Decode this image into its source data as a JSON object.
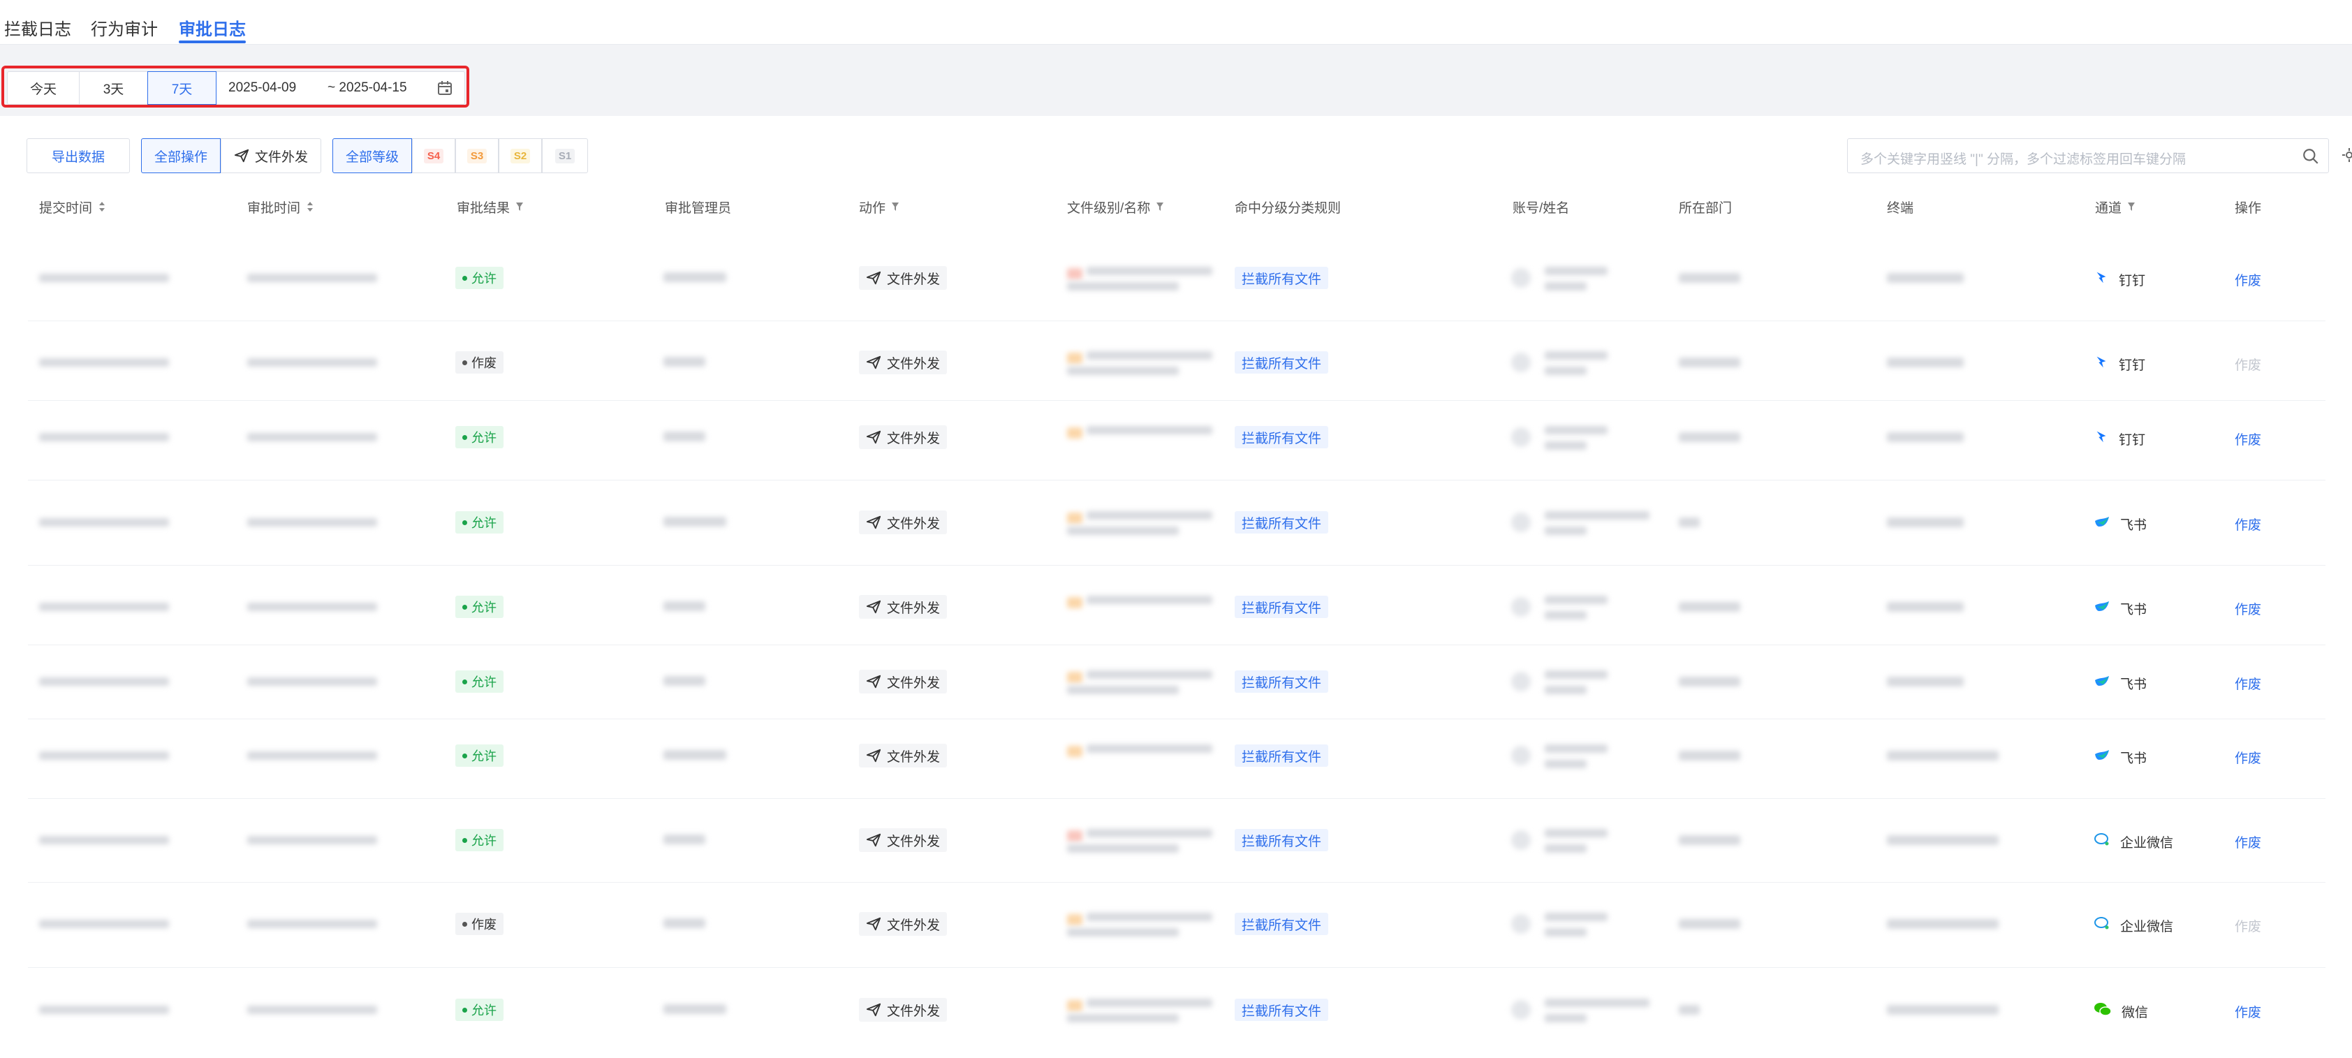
{
  "top_tabs": [
    {
      "label": "拦截日志",
      "active": false
    },
    {
      "label": "行为审计",
      "active": false
    },
    {
      "label": "审批日志",
      "active": true
    }
  ],
  "date_filter": {
    "buttons": [
      {
        "label": "今天",
        "active": false
      },
      {
        "label": "3天",
        "active": false
      },
      {
        "label": "7天",
        "active": true
      }
    ],
    "start": "2025-04-09",
    "end": "~ 2025-04-15"
  },
  "toolbar": {
    "export_label": "导出数据",
    "operation_all": "全部操作",
    "operation_send": "文件外发",
    "level_all": "全部等级",
    "levels": [
      {
        "label": "S4",
        "color": "#f5604c",
        "bg": "#fdecea"
      },
      {
        "label": "S3",
        "color": "#f29a3c",
        "bg": "#fef3e6"
      },
      {
        "label": "S2",
        "color": "#e8b53a",
        "bg": "#fdf6e0"
      },
      {
        "label": "S1",
        "color": "#a8adb7",
        "bg": "#f1f2f4"
      }
    ],
    "search_placeholder": "多个关键字用竖线 \"|\" 分隔，多个过滤标签用回车键分隔"
  },
  "table": {
    "headers": {
      "submit_time": "提交时间",
      "approve_time": "审批时间",
      "result": "审批结果",
      "admin": "审批管理员",
      "action": "动作",
      "file": "文件级别/名称",
      "rule": "命中分级分类规则",
      "account": "账号/姓名",
      "dept": "所在部门",
      "terminal": "终端",
      "channel": "通道",
      "op": "操作"
    },
    "rows": [
      {
        "result": "允许",
        "allowed": true,
        "action": "文件外发",
        "rule": "拦截所有文件",
        "channel": "钉钉",
        "channel_icon": "dingtalk-icon",
        "op": "作废",
        "op_enabled": true
      },
      {
        "result": "作废",
        "allowed": false,
        "action": "文件外发",
        "rule": "拦截所有文件",
        "channel": "钉钉",
        "channel_icon": "dingtalk-icon",
        "op": "作废",
        "op_enabled": false
      },
      {
        "result": "允许",
        "allowed": true,
        "action": "文件外发",
        "rule": "拦截所有文件",
        "channel": "钉钉",
        "channel_icon": "dingtalk-icon",
        "op": "作废",
        "op_enabled": true
      },
      {
        "result": "允许",
        "allowed": true,
        "action": "文件外发",
        "rule": "拦截所有文件",
        "channel": "飞书",
        "channel_icon": "feishu-icon",
        "op": "作废",
        "op_enabled": true
      },
      {
        "result": "允许",
        "allowed": true,
        "action": "文件外发",
        "rule": "拦截所有文件",
        "channel": "飞书",
        "channel_icon": "feishu-icon",
        "op": "作废",
        "op_enabled": true
      },
      {
        "result": "允许",
        "allowed": true,
        "action": "文件外发",
        "rule": "拦截所有文件",
        "channel": "飞书",
        "channel_icon": "feishu-icon",
        "op": "作废",
        "op_enabled": true
      },
      {
        "result": "允许",
        "allowed": true,
        "action": "文件外发",
        "rule": "拦截所有文件",
        "channel": "飞书",
        "channel_icon": "feishu-icon",
        "op": "作废",
        "op_enabled": true
      },
      {
        "result": "允许",
        "allowed": true,
        "action": "文件外发",
        "rule": "拦截所有文件",
        "channel": "企业微信",
        "channel_icon": "wecom-icon",
        "op": "作废",
        "op_enabled": true
      },
      {
        "result": "作废",
        "allowed": false,
        "action": "文件外发",
        "rule": "拦截所有文件",
        "channel": "企业微信",
        "channel_icon": "wecom-icon",
        "op": "作废",
        "op_enabled": false
      },
      {
        "result": "允许",
        "allowed": true,
        "action": "文件外发",
        "rule": "拦截所有文件",
        "channel": "微信",
        "channel_icon": "wechat-icon",
        "op": "作废",
        "op_enabled": true
      }
    ]
  },
  "colors": {
    "accent": "#2f6feb",
    "highlight": "#e8262b",
    "allow_green": "#1aa34a"
  }
}
